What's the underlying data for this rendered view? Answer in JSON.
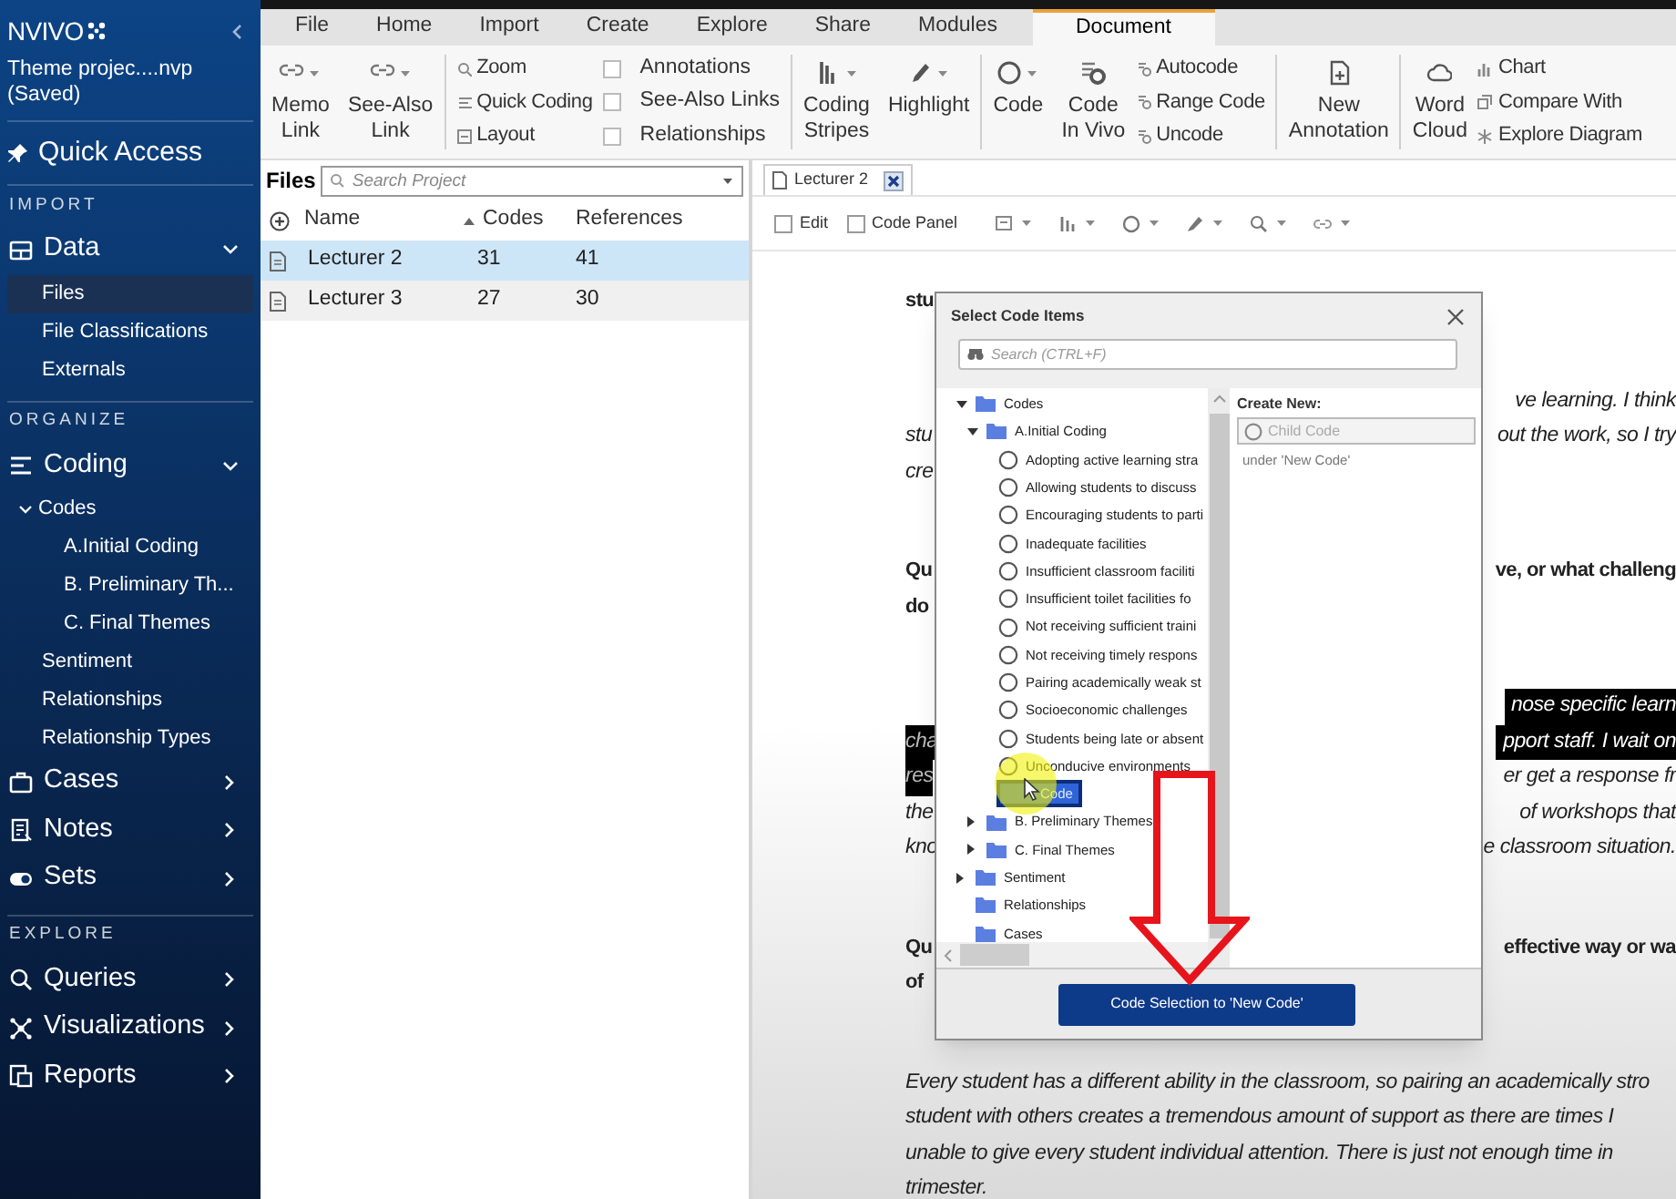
{
  "sidebar": {
    "logo": "NVIVO",
    "project": "Theme projec....nvp",
    "project_state": "(Saved)",
    "quick_access": "Quick Access",
    "sections": [
      {
        "heading": "IMPORT",
        "items": [
          {
            "label": "Data",
            "expanded": true,
            "children": [
              {
                "label": "Files",
                "selected": true
              },
              {
                "label": "File Classifications",
                "selected": false
              },
              {
                "label": "Externals",
                "selected": false
              }
            ]
          }
        ]
      },
      {
        "heading": "ORGANIZE",
        "items": [
          {
            "label": "Coding",
            "expanded": true,
            "children": [
              {
                "label": "Codes",
                "selected": false,
                "expanded": true,
                "children": [
                  {
                    "label": "A.Initial Coding",
                    "selected": false
                  },
                  {
                    "label": "B. Preliminary Th...",
                    "selected": false
                  },
                  {
                    "label": "C. Final Themes",
                    "selected": false
                  }
                ]
              },
              {
                "label": "Sentiment",
                "selected": false
              },
              {
                "label": "Relationships",
                "selected": false
              },
              {
                "label": "Relationship Types",
                "selected": false
              }
            ]
          },
          {
            "label": "Cases",
            "expanded": false
          },
          {
            "label": "Notes",
            "expanded": false
          },
          {
            "label": "Sets",
            "expanded": false
          }
        ]
      },
      {
        "heading": "EXPLORE",
        "items": [
          {
            "label": "Queries",
            "expanded": false
          },
          {
            "label": "Visualizations",
            "expanded": false
          },
          {
            "label": "Reports",
            "expanded": false
          }
        ]
      }
    ]
  },
  "ribbon": {
    "tabs": [
      {
        "label": "File",
        "selected": false
      },
      {
        "label": "Home",
        "selected": false
      },
      {
        "label": "Import",
        "selected": false
      },
      {
        "label": "Create",
        "selected": false
      },
      {
        "label": "Explore",
        "selected": false
      },
      {
        "label": "Share",
        "selected": false
      },
      {
        "label": "Modules",
        "selected": false
      },
      {
        "label": "Document",
        "selected": true
      }
    ],
    "sections": [
      [
        {
          "kind": "large",
          "buttons": [
            {
              "lines": [
                "Memo",
                "Link"
              ],
              "dropdown": true
            },
            {
              "lines": [
                "See-Also",
                "Link"
              ],
              "dropdown": true
            }
          ]
        }
      ],
      [
        {
          "kind": "small",
          "items": [
            {
              "label": "Zoom"
            },
            {
              "label": "Quick Coding"
            },
            {
              "label": "Layout"
            }
          ]
        },
        {
          "kind": "checks",
          "items": [
            {
              "label": "Annotations",
              "checked": false
            },
            {
              "label": "See-Also Links",
              "checked": false
            },
            {
              "label": "Relationships",
              "checked": false
            }
          ]
        }
      ],
      [
        {
          "kind": "large",
          "buttons": [
            {
              "lines": [
                "Coding",
                "Stripes"
              ],
              "dropdown": true
            },
            {
              "lines": [
                "Highlight"
              ],
              "dropdown": true
            }
          ]
        }
      ],
      [
        {
          "kind": "large",
          "buttons": [
            {
              "lines": [
                "Code"
              ],
              "dropdown": true
            },
            {
              "lines": [
                "Code",
                "In Vivo"
              ],
              "dropdown": false
            }
          ]
        },
        {
          "kind": "small",
          "items": [
            {
              "label": "Autocode"
            },
            {
              "label": "Range Code"
            },
            {
              "label": "Uncode"
            }
          ]
        }
      ],
      [
        {
          "kind": "large",
          "buttons": [
            {
              "lines": [
                "New",
                "Annotation"
              ],
              "dropdown": false
            }
          ]
        }
      ],
      [
        {
          "kind": "large",
          "buttons": [
            {
              "lines": [
                "Word",
                "Cloud"
              ],
              "dropdown": false
            }
          ]
        },
        {
          "kind": "small",
          "items": [
            {
              "label": "Chart"
            },
            {
              "label": "Compare With"
            },
            {
              "label": "Explore Diagram"
            }
          ]
        }
      ]
    ]
  },
  "files": {
    "title": "Files",
    "search": {
      "placeholder": "Search Project"
    },
    "columns": [
      "Name",
      "Codes",
      "References"
    ],
    "rows": [
      {
        "cells": [
          "Lecturer 2",
          "31",
          "41"
        ],
        "selected": true
      },
      {
        "cells": [
          "Lecturer 3",
          "27",
          "30"
        ],
        "selected": false
      }
    ]
  },
  "document": {
    "tab": {
      "label": "Lecturer 2"
    },
    "toolbar": {
      "checks": [
        {
          "label": "Edit",
          "checked": false
        },
        {
          "label": "Code Panel",
          "checked": false
        }
      ]
    },
    "paragraphs": [
      {
        "kind": "question",
        "lines": [
          {
            "left": {
              "text": "stu",
              "highlighted": false
            }
          }
        ]
      },
      {
        "kind": "answer",
        "lines": [
          {
            "right": {
              "text": "ve learning.  I  think",
              "highlighted": false
            }
          },
          {
            "left": {
              "text": "stu",
              "highlighted": false
            },
            "right": {
              "text": "out the work,  so I try",
              "highlighted": false
            }
          },
          {
            "left": {
              "text": "cre",
              "highlighted": false
            }
          }
        ]
      },
      {
        "kind": "question",
        "lines": [
          {
            "left": {
              "text": "Qu",
              "highlighted": false
            },
            "right": {
              "text": "ve, or what challeng",
              "highlighted": false
            }
          },
          {
            "left": {
              "text": "do",
              "highlighted": false
            }
          }
        ]
      },
      {
        "kind": "answer",
        "lines": [
          {
            "right": {
              "text": "nose  specific  learn",
              "highlighted": true
            }
          },
          {
            "left": {
              "text": "cha",
              "highlighted": true
            },
            "right": {
              "text": "pport staff. I wait on",
              "highlighted": true
            }
          },
          {
            "left": {
              "text": "res",
              "highlighted": true
            },
            "right": {
              "text": "er get a response fr",
              "highlighted": false
            }
          },
          {
            "left": {
              "text": "the",
              "highlighted": false
            },
            "right": {
              "text": "of  workshops that",
              "highlighted": false
            }
          },
          {
            "left": {
              "text": "kno",
              "highlighted": false
            },
            "right": {
              "text": "e classroom situation.",
              "highlighted": false
            }
          }
        ]
      },
      {
        "kind": "question",
        "lines": [
          {
            "left": {
              "text": "Qu",
              "highlighted": false
            },
            "right": {
              "text": "effective way or wa",
              "highlighted": false
            }
          },
          {
            "left": {
              "text": "of",
              "highlighted": false
            }
          }
        ]
      },
      {
        "kind": "answer",
        "lines": [
          {
            "left": {
              "text": "Every student has a different ability in the classroom, so pairing an academically stro",
              "highlighted": false
            }
          },
          {
            "left": {
              "text": "student with others creates a tremendous amount of support as there are times I",
              "highlighted": false
            }
          },
          {
            "left": {
              "text": "unable to give every student individual attention.  There is just not enough time in",
              "highlighted": false
            }
          },
          {
            "left": {
              "text": "trimester.",
              "highlighted": false
            }
          }
        ]
      }
    ]
  },
  "dialog": {
    "title": "Select Code Items",
    "search": {
      "placeholder": "Search (CTRL+F)"
    },
    "tree": [
      {
        "label": "Codes",
        "kind": "folder",
        "expanded": true,
        "selected": false,
        "children": [
          {
            "label": "A.Initial Coding",
            "kind": "folder",
            "expanded": true,
            "selected": false,
            "children": [
              {
                "label": "Adopting  active learning stra",
                "kind": "code",
                "selected": false
              },
              {
                "label": "Allowing students to discuss",
                "kind": "code",
                "selected": false
              },
              {
                "label": "Encouraging students to parti",
                "kind": "code",
                "selected": false
              },
              {
                "label": "Inadequate facilities",
                "kind": "code",
                "selected": false
              },
              {
                "label": "Insufficient classroom faciliti",
                "kind": "code",
                "selected": false
              },
              {
                "label": "Insufficient toilet facilities fo",
                "kind": "code",
                "selected": false
              },
              {
                "label": "Not receiving sufficient traini",
                "kind": "code",
                "selected": false
              },
              {
                "label": "Not receiving timely respons",
                "kind": "code",
                "selected": false
              },
              {
                "label": "Pairing academically weak st",
                "kind": "code",
                "selected": false
              },
              {
                "label": "Socioeconomic challenges",
                "kind": "code",
                "selected": false
              },
              {
                "label": "Students being late or absent",
                "kind": "code",
                "selected": false
              },
              {
                "label": "Unconducive environments",
                "kind": "code",
                "selected": false
              },
              {
                "label": "Code",
                "kind": "new",
                "selected": true
              }
            ]
          },
          {
            "label": "B. Preliminary Themes",
            "kind": "folder",
            "expanded": false,
            "selected": false
          },
          {
            "label": "C. Final Themes",
            "kind": "folder",
            "expanded": false,
            "selected": false
          }
        ]
      },
      {
        "label": "Sentiment",
        "kind": "folder",
        "expanded": false,
        "selected": false
      },
      {
        "label": "Relationships",
        "kind": "folder",
        "selected": false
      },
      {
        "label": "Cases",
        "kind": "folder",
        "selected": false
      }
    ],
    "create_new": {
      "heading": "Create New:",
      "field": {
        "placeholder": "Child Code"
      },
      "note": "under 'New Code'"
    },
    "button": "Code Selection to 'New Code'"
  }
}
